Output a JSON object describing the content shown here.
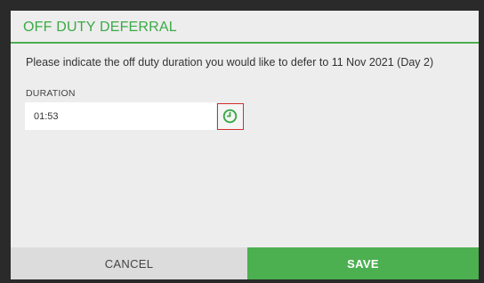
{
  "dialog": {
    "title": "OFF DUTY DEFERRAL",
    "message": "Please indicate the off duty duration you would like to defer to 11 Nov 2021 (Day 2)"
  },
  "duration_field": {
    "label": "DURATION",
    "value": "01:53",
    "icon": "clock-icon"
  },
  "buttons": {
    "cancel_label": "CANCEL",
    "save_label": "SAVE"
  },
  "colors": {
    "accent": "#4caf50",
    "title_text": "#3aaa45",
    "highlight_border": "#d32f2f",
    "dialog_background": "#ededed",
    "cancel_background": "#dcdcdc",
    "backdrop": "#2a2a2a"
  }
}
